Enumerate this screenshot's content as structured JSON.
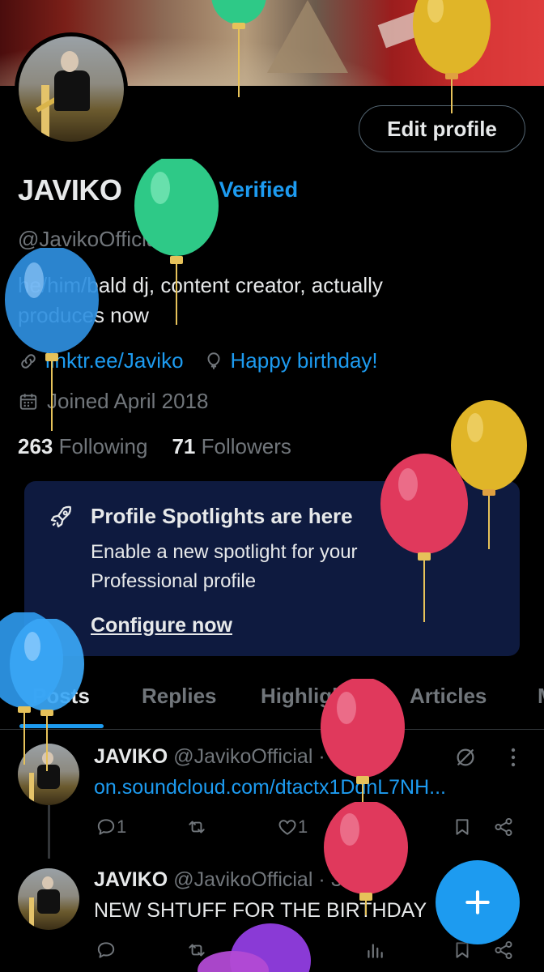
{
  "profile": {
    "display_name": "JAVIKO",
    "verify_cta": "Get Verified",
    "handle": "@JavikoOfficial",
    "bio": "he/him/bald dj, content creator, actually produces now",
    "link": "linktr.ee/Javiko",
    "birthday": "Happy birthday!",
    "joined": "Joined April 2018",
    "following_count": "263",
    "following_label": "Following",
    "followers_count": "71",
    "followers_label": "Followers",
    "edit_button": "Edit profile"
  },
  "spotlight": {
    "title": "Profile Spotlights are here",
    "description": "Enable a new spotlight for your Professional profile",
    "link": "Configure now"
  },
  "tabs": [
    {
      "label": "Posts"
    },
    {
      "label": "Replies"
    },
    {
      "label": "Highlights"
    },
    {
      "label": "Articles"
    }
  ],
  "tweets": [
    {
      "name": "JAVIKO",
      "handle": "@JavikoOfficial",
      "time": "· 51s",
      "text": "on.soundcloud.com/dtactx1DdnL7NH...",
      "replies": "1",
      "likes": "1"
    },
    {
      "name": "JAVIKO",
      "handle": "@JavikoOfficial",
      "time": "· 3s",
      "text": "NEW SHTUFF FOR THE BIRTHDAY"
    }
  ],
  "colors": {
    "accent": "#1d9bf0",
    "background": "#000000",
    "muted_text": "#71767b",
    "spotlight_bg": "#0e1a3f"
  },
  "icons": [
    "link-icon",
    "balloon-icon",
    "calendar-icon",
    "rocket-icon",
    "reply-icon",
    "retweet-icon",
    "like-icon",
    "views-icon",
    "bookmark-icon",
    "share-icon",
    "more-icon",
    "compose-icon",
    "verified-badge-icon"
  ]
}
